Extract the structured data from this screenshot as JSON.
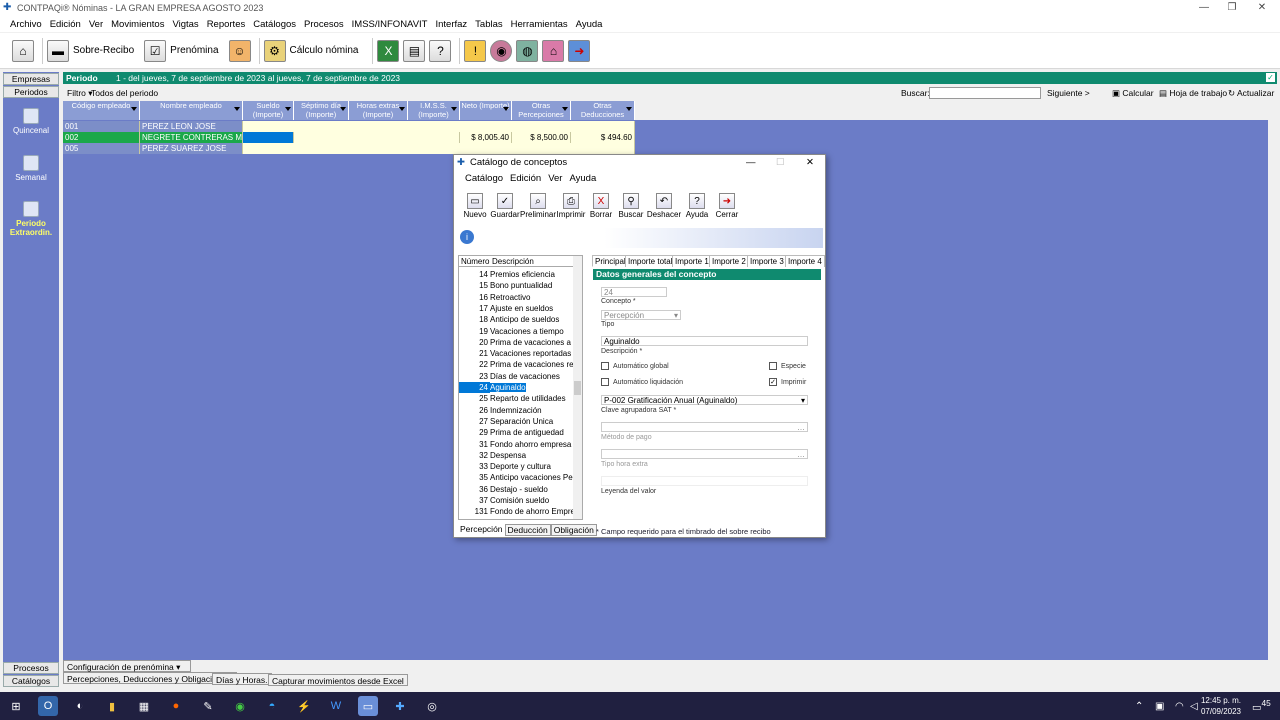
{
  "window": {
    "title": "CONTPAQi® Nóminas - LA GRAN EMPRESA AGOSTO 2023"
  },
  "menu": [
    "Archivo",
    "Edición",
    "Ver",
    "Movimientos",
    "Vigtas",
    "Reportes",
    "Catálogos",
    "Procesos",
    "IMSS/INFONAVIT",
    "Interfaz",
    "Tablas",
    "Herramientas",
    "Ayuda"
  ],
  "toolbar": {
    "sobre_recibo": "Sobre-Recibo",
    "prenomina": "Prenómina",
    "calculo": "Cálculo nómina"
  },
  "leftnav": {
    "empresas": "Empresas",
    "periodos": "Periodos",
    "quincenal": "Quincenal",
    "semanal": "Semanal",
    "extra1": "Periodo",
    "extra2": "Extraordin.",
    "procesos": "Procesos",
    "catalogos": "Catálogos"
  },
  "period": {
    "label": "Periodo",
    "text": "1 - del jueves, 7 de septiembre de 2023 al jueves, 7 de septiembre de 2023"
  },
  "filter": {
    "label": "Filtro",
    "value": "Todos del periodo",
    "search_label": "Buscar:",
    "next": "Siguiente >",
    "calc": "Calcular",
    "sheet": "Hoja de trabajo",
    "refresh": "Actualizar"
  },
  "grid": {
    "headers": [
      "Código empleado",
      "Nombre empleado",
      "Sueldo (Importe)",
      "Séptimo día (Importe)",
      "Horas extras (Importe)",
      "I.M.S.S. (Importe)",
      "Neto (Importe)",
      "Otras Percepciones",
      "Otras Deducciones"
    ],
    "rows": [
      {
        "code": "001",
        "name": "PEREZ LEON JOSE",
        "neto": "",
        "perc": "",
        "ded": ""
      },
      {
        "code": "002",
        "name": "NEGRETE CONTRERAS MARI",
        "neto": "$ 8,005.40",
        "perc": "$ 8,500.00",
        "ded": "$ 494.60"
      },
      {
        "code": "005",
        "name": "PEREZ SUAREZ JOSE",
        "neto": "",
        "perc": "",
        "ded": ""
      }
    ]
  },
  "bottom": {
    "config": "Configuración de prenómina",
    "tab1": "Percepciones, Deducciones y Obligaciones.",
    "tab2": "Días y Horas.",
    "tab3": "Capturar movimientos desde Excel"
  },
  "dialog": {
    "title": "Catálogo de conceptos",
    "menu": [
      "Catálogo",
      "Edición",
      "Ver",
      "Ayuda"
    ],
    "tools": [
      "Nuevo",
      "Guardar",
      "Preliminar",
      "Imprimir",
      "Borrar",
      "Buscar",
      "Deshacer",
      "Ayuda",
      "Cerrar"
    ],
    "list_headers": {
      "num": "Número",
      "desc": "Descripción"
    },
    "list": [
      {
        "n": "14",
        "d": "Premios eficiencia"
      },
      {
        "n": "15",
        "d": "Bono puntualidad"
      },
      {
        "n": "16",
        "d": "Retroactivo"
      },
      {
        "n": "17",
        "d": "Ajuste en sueldos"
      },
      {
        "n": "18",
        "d": "Anticipo de sueldos"
      },
      {
        "n": "19",
        "d": "Vacaciones a tiempo"
      },
      {
        "n": "20",
        "d": "Prima de vacaciones a tie"
      },
      {
        "n": "21",
        "d": "Vacaciones reportadas $"
      },
      {
        "n": "22",
        "d": "Prima de vacaciones repo"
      },
      {
        "n": "23",
        "d": "Días de vacaciones"
      },
      {
        "n": "24",
        "d": "Aguinaldo"
      },
      {
        "n": "25",
        "d": "Reparto de utilidades"
      },
      {
        "n": "26",
        "d": "Indemnización"
      },
      {
        "n": "27",
        "d": "Separación Unica"
      },
      {
        "n": "29",
        "d": "Prima de antiguedad"
      },
      {
        "n": "31",
        "d": "Fondo ahorro empresa"
      },
      {
        "n": "32",
        "d": "Despensa"
      },
      {
        "n": "33",
        "d": "Deporte y cultura"
      },
      {
        "n": "35",
        "d": "Anticipo vacaciones Perc"
      },
      {
        "n": "36",
        "d": "Destajo - sueldo"
      },
      {
        "n": "37",
        "d": "Comisión sueldo"
      },
      {
        "n": "131",
        "d": "Fondo de ahorro Empresa"
      }
    ],
    "bottom_tabs": [
      "Percepción",
      "Deducción",
      "Obligación"
    ],
    "tabs": [
      "Principal",
      "Importe total",
      "Importe 1",
      "Importe 2",
      "Importe 3",
      "Importe 4"
    ],
    "section": "Datos generales del concepto",
    "concepto_val": "24",
    "concepto_lbl": "Concepto *",
    "tipo_val": "Percepción",
    "tipo_lbl": "Tipo",
    "desc_val": "Aguinaldo",
    "desc_lbl": "Descripción *",
    "auto_global": "Automático global",
    "especie": "Especie",
    "auto_liq": "Automático liquidación",
    "imprimir": "Imprimir",
    "sat_val": "P-002  Gratificación Anual (Aguinaldo)",
    "sat_lbl": "Clave agrupadora SAT *",
    "metodo_lbl": "Método de pago",
    "tipo_hora_lbl": "Tipo hora extra",
    "leyenda_lbl": "Leyenda del valor",
    "note": "* Campo requerido para el timbrado del sobre recibo"
  },
  "taskbar": {
    "time": "12:45 p. m.",
    "date": "07/09/2023",
    "badge": "45"
  }
}
